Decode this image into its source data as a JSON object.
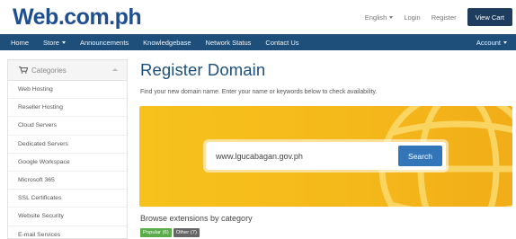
{
  "header": {
    "logo": "Web.com.ph",
    "language": "English",
    "login": "Login",
    "register": "Register",
    "view_cart": "View Cart"
  },
  "navbar": {
    "items": [
      {
        "label": "Home"
      },
      {
        "label": "Store",
        "dropdown": true
      },
      {
        "label": "Announcements"
      },
      {
        "label": "Knowledgebase"
      },
      {
        "label": "Network Status"
      },
      {
        "label": "Contact Us"
      }
    ],
    "account": "Account"
  },
  "sidebar": {
    "title": "Categories",
    "items": [
      {
        "label": "Web Hosting"
      },
      {
        "label": "Reseller Hosting"
      },
      {
        "label": "Cloud Servers"
      },
      {
        "label": "Dedicated Servers"
      },
      {
        "label": "Google Workspace"
      },
      {
        "label": "Microsoft 365"
      },
      {
        "label": "SSL Certificates"
      },
      {
        "label": "Website Security"
      },
      {
        "label": "E-mail Services"
      }
    ]
  },
  "main": {
    "title": "Register Domain",
    "subtitle": "Find your new domain name. Enter your name or keywords below to check availability.",
    "search": {
      "value": "www.lgucabagan.gov.ph",
      "button": "Search"
    },
    "browse_title": "Browse extensions by category",
    "badges": [
      {
        "label": "Popular (6)"
      },
      {
        "label": "Other (7)"
      }
    ]
  },
  "colors": {
    "brand": "#1d4f91",
    "navbar": "#1d4f7a",
    "banner": "#f5bb1b",
    "search_button": "#3276b9",
    "badge_popular": "#5aab4a",
    "badge_other": "#666666"
  }
}
